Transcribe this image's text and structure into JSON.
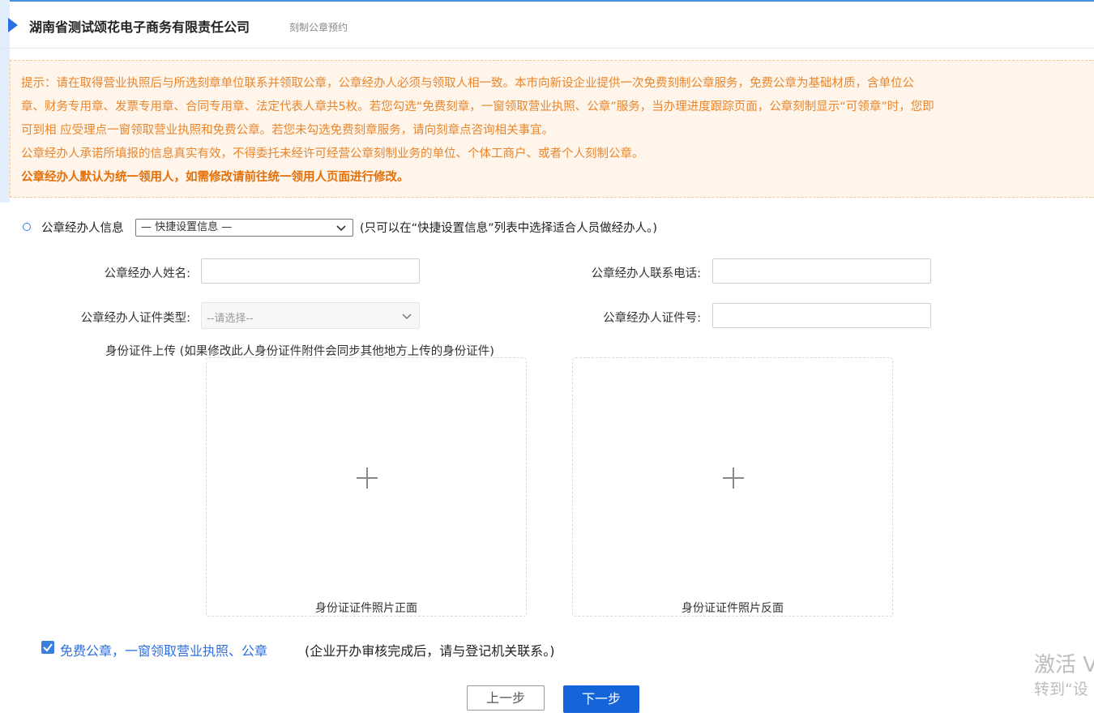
{
  "header": {
    "company": "湖南省测试颂花电子商务有限责任公司",
    "subtitle": "刻制公章预约"
  },
  "notice": {
    "line1": "提示：请在取得营业执照后与所选刻章单位联系并领取公章，公章经办人必须与领取人相一致。本市向新设企业提供一次免费刻制公章服务，免费公章为基础材质，含单位公",
    "line2": "章、财务专用章、发票专用章、合同专用章、法定代表人章共5枚。若您勾选“免费刻章，一窗领取营业执照、公章”服务，当办理进度跟踪页面，公章刻制显示“可领章”时，您即",
    "line3": "可到相 应受理点一窗领取营业执照和免费公章。若您未勾选免费刻章服务，请向刻章点咨询相关事宜。",
    "line4": "公章经办人承诺所填报的信息真实有效，不得委托未经许可经营公章刻制业务的单位、个体工商户、或者个人刻制公章。",
    "line5_bold": "公章经办人默认为统一领用人，如需修改请前往统一领用人页面进行修改。"
  },
  "section": {
    "label": "公章经办人信息",
    "quick_select_value": "— 快捷设置信息 —",
    "hint": "(只可以在“快捷设置信息”列表中选择适合人员做经办人。)"
  },
  "form": {
    "name_label": "公章经办人姓名:",
    "name_value": "",
    "phone_label": "公章经办人联系电话:",
    "phone_value": "",
    "id_type_label": "公章经办人证件类型:",
    "id_type_value": "--请选择--",
    "id_no_label": "公章经办人证件号:",
    "id_no_value": ""
  },
  "upload": {
    "title": "身份证件上传 (如果修改此人身份证件附件会同步其他地方上传的身份证件)",
    "front_caption": "身份证证件照片正面",
    "back_caption": "身份证证件照片反面"
  },
  "option": {
    "checked": true,
    "label": "免费公章，一窗领取营业执照、公章",
    "hint": "(企业开办审核完成后，请与登记机关联系。)"
  },
  "buttons": {
    "prev": "上一步",
    "next": "下一步"
  },
  "watermark": {
    "line1": "激活 V",
    "line2": "转到“设"
  },
  "colors": {
    "accent": "#1565d8",
    "notice_text": "#e8862e",
    "notice_bg": "#fff5ea"
  }
}
